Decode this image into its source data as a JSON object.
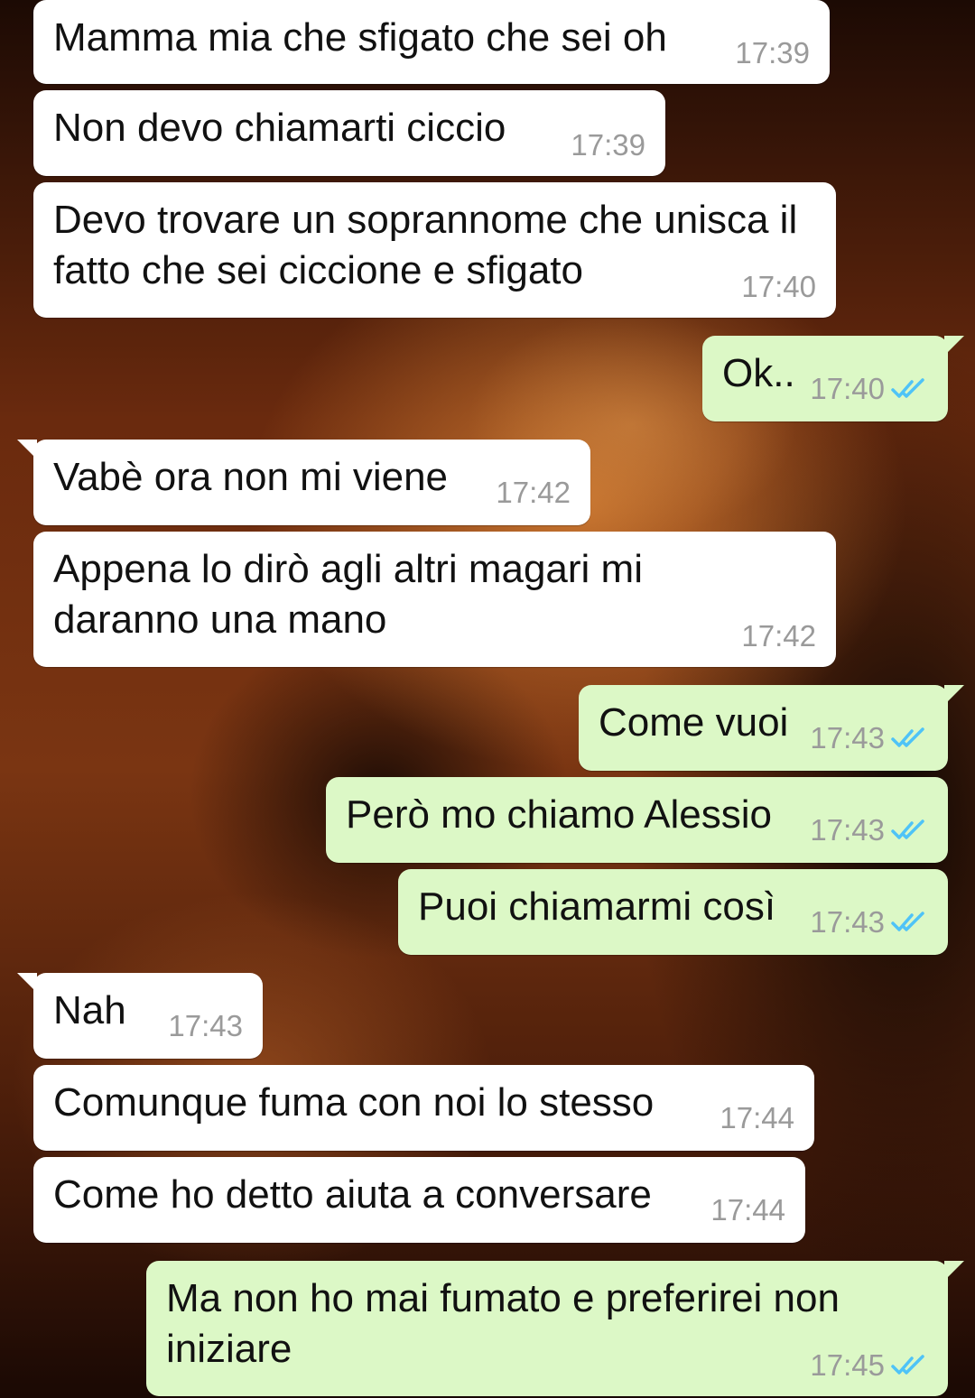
{
  "chat": {
    "messages": [
      {
        "direction": "in",
        "text": "Mamma mia che sfigato che sei oh",
        "time": "17:39"
      },
      {
        "direction": "in",
        "text": "Non devo chiamarti ciccio",
        "time": "17:39"
      },
      {
        "direction": "in",
        "text": "Devo trovare un soprannome che unisca il fatto che sei ciccione e sfigato",
        "time": "17:40"
      },
      {
        "direction": "out",
        "text": "Ok..",
        "time": "17:40",
        "status": "read"
      },
      {
        "direction": "in",
        "text": "Vabè ora non mi viene",
        "time": "17:42"
      },
      {
        "direction": "in",
        "text": "Appena lo dirò agli altri magari mi daranno una mano",
        "time": "17:42"
      },
      {
        "direction": "out",
        "text": "Come vuoi",
        "time": "17:43",
        "status": "read"
      },
      {
        "direction": "out",
        "text": "Però mo chiamo Alessio",
        "time": "17:43",
        "status": "read"
      },
      {
        "direction": "out",
        "text": "Puoi chiamarmi così",
        "time": "17:43",
        "status": "read"
      },
      {
        "direction": "in",
        "text": "Nah",
        "time": "17:43"
      },
      {
        "direction": "in",
        "text": "Comunque fuma con noi lo stesso",
        "time": "17:44"
      },
      {
        "direction": "in",
        "text": "Come ho detto aiuta a conversare",
        "time": "17:44"
      },
      {
        "direction": "out",
        "text": "Ma non ho mai fumato e preferirei non iniziare",
        "time": "17:45",
        "status": "read"
      }
    ]
  },
  "colors": {
    "incoming_bubble": "#ffffff",
    "outgoing_bubble": "#dcf8c6",
    "read_tick": "#4fc3f7",
    "timestamp": "#9a9a9a"
  },
  "icons": {
    "read_status": "double-check-icon"
  }
}
